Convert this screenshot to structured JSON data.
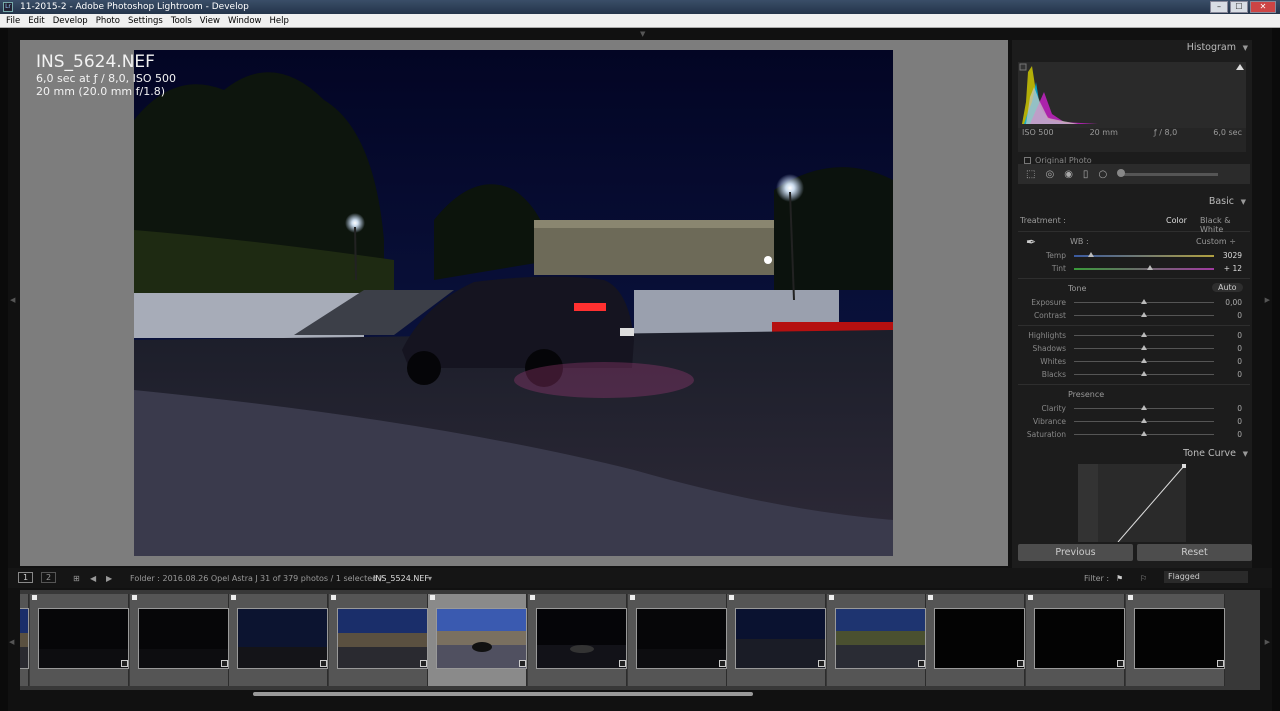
{
  "window": {
    "title": "11-2015-2 - Adobe Photoshop Lightroom - Develop",
    "logo": "Lr",
    "buttons": [
      "–",
      "☐",
      "✕"
    ]
  },
  "menu": [
    "File",
    "Edit",
    "Develop",
    "Photo",
    "Settings",
    "Tools",
    "View",
    "Window",
    "Help"
  ],
  "photo_info": {
    "filename": "INS_5624.NEF",
    "exposure": "6,0 sec at ƒ / 8,0, ISO 500",
    "lens": "20 mm (20.0 mm f/1.8)"
  },
  "histogram": {
    "title": "Histogram",
    "iso": "ISO 500",
    "focal": "20 mm",
    "aperture": "ƒ / 8,0",
    "shutter": "6,0 sec",
    "original_photo": "Original Photo"
  },
  "basic": {
    "title": "Basic",
    "treatment_label": "Treatment :",
    "color": "Color",
    "bw": "Black & White",
    "wb_label": "WB :",
    "wb_value": "Custom ÷",
    "temp_label": "Temp",
    "temp_value": "3029",
    "temp_pos": 0.12,
    "tint_label": "Tint",
    "tint_value": "+ 12",
    "tint_pos": 0.54,
    "tone_label": "Tone",
    "auto": "Auto",
    "sliders_tone": [
      {
        "label": "Exposure",
        "value": "0,00",
        "pos": 0.5
      },
      {
        "label": "Contrast",
        "value": "0",
        "pos": 0.5
      }
    ],
    "sliders_tone2": [
      {
        "label": "Highlights",
        "value": "0",
        "pos": 0.5
      },
      {
        "label": "Shadows",
        "value": "0",
        "pos": 0.5
      },
      {
        "label": "Whites",
        "value": "0",
        "pos": 0.5
      },
      {
        "label": "Blacks",
        "value": "0",
        "pos": 0.5
      }
    ],
    "presence_label": "Presence",
    "sliders_presence": [
      {
        "label": "Clarity",
        "value": "0",
        "pos": 0.5
      },
      {
        "label": "Vibrance",
        "value": "0",
        "pos": 0.5
      },
      {
        "label": "Saturation",
        "value": "0",
        "pos": 0.5
      }
    ]
  },
  "tone_curve": {
    "title": "Tone Curve"
  },
  "buttons": {
    "previous": "Previous",
    "reset": "Reset"
  },
  "filmbar": {
    "view1": "1",
    "view2": "2",
    "folder": "Folder : 2016.08.26 Opel Astra J",
    "count": "31 of 379 photos / 1 selected /",
    "selected_file": "INS_5524.NEF",
    "filter_label": "Filter :",
    "filter_value": "Flagged"
  },
  "thumbnails": [
    "dark",
    "dark",
    "dusk",
    "stadium",
    "selected",
    "car",
    "dark",
    "car2",
    "stadium2",
    "black",
    "black",
    "black"
  ]
}
